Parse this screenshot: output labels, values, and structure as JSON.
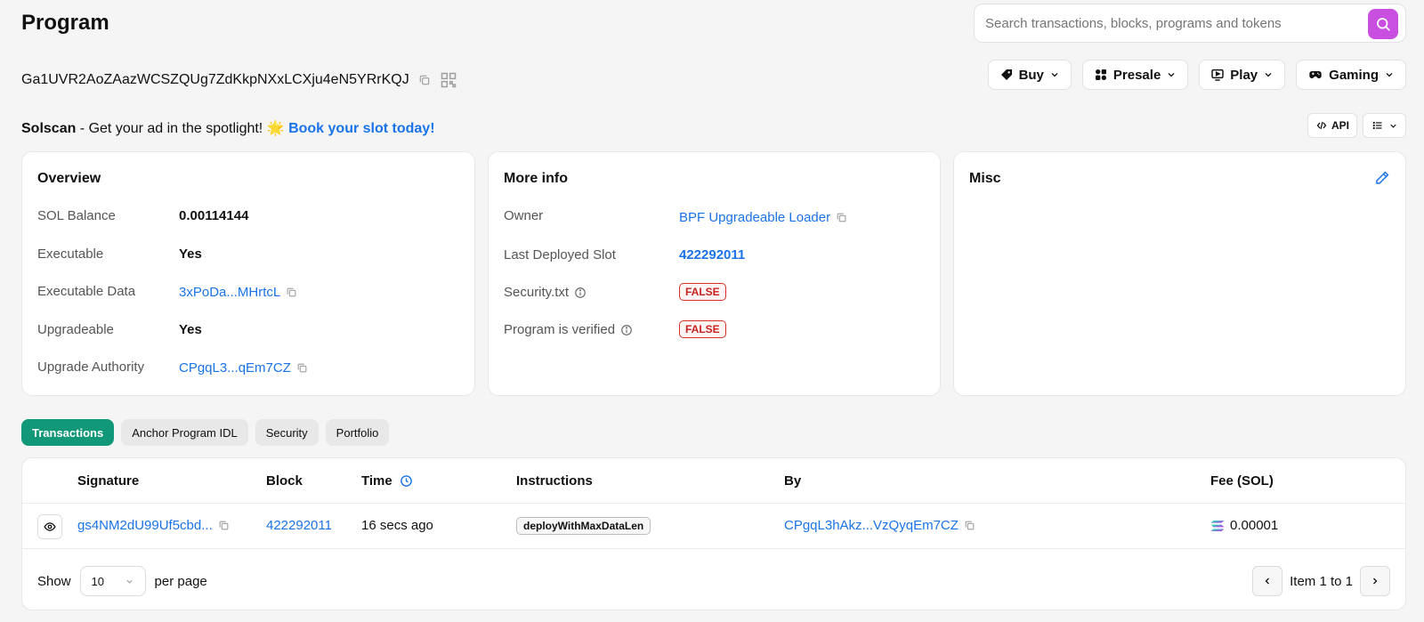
{
  "header": {
    "title": "Program",
    "search_placeholder": "Search transactions, blocks, programs and tokens"
  },
  "address": "Ga1UVR2AoZAazWCSZQUg7ZdKkpNXxLCXju4eN5YRrKQJ",
  "menu": {
    "buy": "Buy",
    "presale": "Presale",
    "play": "Play",
    "gaming": "Gaming"
  },
  "ad": {
    "brand": "Solscan",
    "text": " - Get your ad in the spotlight! ",
    "emoji": "🌟",
    "cta": "Book your slot today!"
  },
  "api_label": "API",
  "overview": {
    "title": "Overview",
    "rows": [
      {
        "label": "SOL Balance",
        "value": "0.00114144"
      },
      {
        "label": "Executable",
        "value": "Yes"
      },
      {
        "label": "Executable Data",
        "value": "3xPoDa...MHrtcL"
      },
      {
        "label": "Upgradeable",
        "value": "Yes"
      },
      {
        "label": "Upgrade Authority",
        "value": "CPgqL3...qEm7CZ"
      }
    ]
  },
  "more_info": {
    "title": "More info",
    "rows": [
      {
        "label": "Owner",
        "value": "BPF Upgradeable Loader"
      },
      {
        "label": "Last Deployed Slot",
        "value": "422292011"
      },
      {
        "label": "Security.txt",
        "value": "FALSE"
      },
      {
        "label": "Program is verified",
        "value": "FALSE"
      }
    ]
  },
  "misc": {
    "title": "Misc"
  },
  "tabs": [
    "Transactions",
    "Anchor Program IDL",
    "Security",
    "Portfolio"
  ],
  "table": {
    "headers": [
      "Signature",
      "Block",
      "Time",
      "Instructions",
      "By",
      "Fee (SOL)"
    ],
    "rows": [
      {
        "signature": "gs4NM2dU99Uf5cbd...",
        "block": "422292011",
        "time": "16 secs ago",
        "instruction": "deployWithMaxDataLen",
        "by": "CPgqL3hAkz...VzQyqEm7CZ",
        "fee": "0.00001"
      }
    ],
    "footer": {
      "show_label": "Show",
      "per_page_value": "10",
      "per_page_label": "per page",
      "page_info": "Item 1 to 1"
    }
  },
  "colors": {
    "accent_green": "#119878",
    "link_blue": "#1a73e8",
    "search_purple": "#c94fe0",
    "false_red": "#c5221f"
  }
}
